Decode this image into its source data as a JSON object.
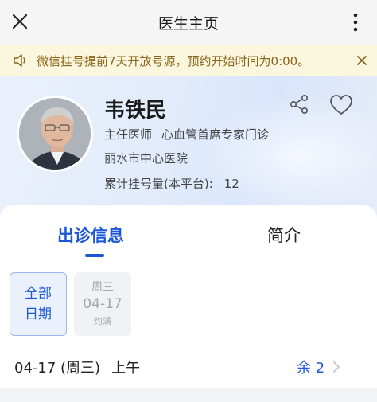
{
  "header": {
    "title": "医生主页",
    "close_icon": "close-icon",
    "more_icon": "more-vertical-icon"
  },
  "notice": {
    "icon": "speaker-icon",
    "text": "微信挂号提前7天开放号源，预约开始时间为0:00。",
    "close_icon": "close-icon"
  },
  "doctor": {
    "name": "韦铁民",
    "title": "主任医师",
    "department": "心血管首席专家门诊",
    "hospital": "丽水市中心医院",
    "appointments_label": "累计挂号量(本平台):",
    "appointments_count": "12"
  },
  "tabs": [
    {
      "label": "出诊信息",
      "active": true
    },
    {
      "label": "简介",
      "active": false
    }
  ],
  "date_filter": {
    "all_line1": "全部",
    "all_line2": "日期",
    "days": [
      {
        "weekday": "周三",
        "date": "04-17",
        "status": "约满"
      }
    ]
  },
  "slot": {
    "date": "04-17 (周三)",
    "period": "上午",
    "remaining": "余 2"
  },
  "colors": {
    "accent": "#1a56d6",
    "notice_text": "#8a6418",
    "notice_bg": "#fbf6de"
  }
}
